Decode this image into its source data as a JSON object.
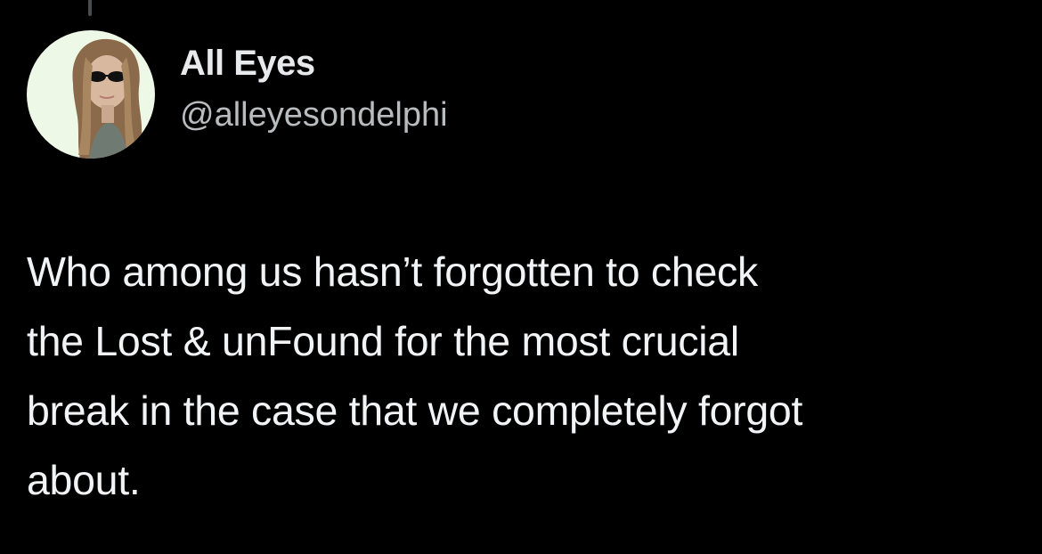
{
  "tweet": {
    "author": {
      "display_name": "All Eyes",
      "handle": "@alleyesondelphi",
      "avatar": "profile-photo-icon"
    },
    "text": "Who among us hasn’t forgotten to check\nthe Lost & unFound for the most crucial\nbreak in the case that we completely forgot\nabout."
  },
  "colors": {
    "background": "#000000",
    "primary_text": "#e7e9ea",
    "secondary_text": "#b9bcbf",
    "avatar_background": "#eef8e6"
  }
}
